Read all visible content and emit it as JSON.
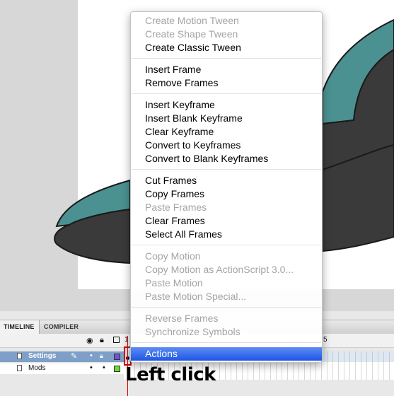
{
  "stage": {
    "colors": {
      "teal": "#4b9191",
      "dark": "#3b3b3b",
      "outline": "#1a1a1a"
    }
  },
  "context_menu": {
    "groups": [
      [
        {
          "label": "Create Motion Tween",
          "enabled": false
        },
        {
          "label": "Create Shape Tween",
          "enabled": false
        },
        {
          "label": "Create Classic Tween",
          "enabled": true
        }
      ],
      [
        {
          "label": "Insert Frame",
          "enabled": true
        },
        {
          "label": "Remove Frames",
          "enabled": true
        }
      ],
      [
        {
          "label": "Insert Keyframe",
          "enabled": true
        },
        {
          "label": "Insert Blank Keyframe",
          "enabled": true
        },
        {
          "label": "Clear Keyframe",
          "enabled": true
        },
        {
          "label": "Convert to Keyframes",
          "enabled": true
        },
        {
          "label": "Convert to Blank Keyframes",
          "enabled": true
        }
      ],
      [
        {
          "label": "Cut Frames",
          "enabled": true
        },
        {
          "label": "Copy Frames",
          "enabled": true
        },
        {
          "label": "Paste Frames",
          "enabled": false
        },
        {
          "label": "Clear Frames",
          "enabled": true
        },
        {
          "label": "Select All Frames",
          "enabled": true
        }
      ],
      [
        {
          "label": "Copy Motion",
          "enabled": false
        },
        {
          "label": "Copy Motion as ActionScript 3.0...",
          "enabled": false
        },
        {
          "label": "Paste Motion",
          "enabled": false
        },
        {
          "label": "Paste Motion Special...",
          "enabled": false
        }
      ],
      [
        {
          "label": "Reverse Frames",
          "enabled": false
        },
        {
          "label": "Synchronize Symbols",
          "enabled": false
        }
      ],
      [
        {
          "label": "Actions",
          "enabled": true,
          "highlighted": true
        }
      ]
    ]
  },
  "timeline": {
    "tabs": [
      "TIMELINE",
      "COMPILER ERRORS"
    ],
    "header_icons": [
      "eye-icon",
      "lock-icon",
      "outline-icon"
    ],
    "frame_numbers": [
      "1",
      "5"
    ],
    "layers": [
      {
        "name": "Settings",
        "selected": true,
        "swatch": "#7a4fd8",
        "icon": "pencil-icon"
      },
      {
        "name": "Mods",
        "selected": false,
        "swatch": "#66dd33"
      }
    ]
  },
  "annotation": {
    "text": "Left click",
    "color": "#d00000"
  }
}
